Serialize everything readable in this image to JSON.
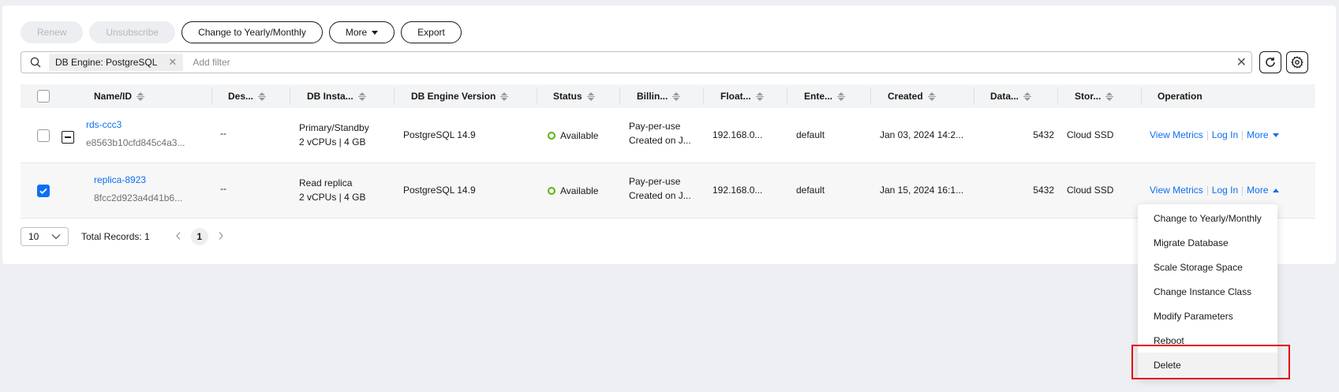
{
  "toolbar": {
    "renew": "Renew",
    "unsubscribe": "Unsubscribe",
    "change": "Change to Yearly/Monthly",
    "more": "More",
    "export": "Export"
  },
  "search": {
    "tag": "DB Engine: PostgreSQL",
    "placeholder": "Add filter"
  },
  "table": {
    "headers": [
      "Name/ID",
      "Des...",
      "DB Insta...",
      "DB Engine Version",
      "Status",
      "Billin...",
      "Float...",
      "Ente...",
      "Created",
      "Data...",
      "Stor...",
      "Operation"
    ],
    "rows": [
      {
        "name": "rds-ccc3",
        "id": "e8563b10cfd845c4a3...",
        "desc": "--",
        "type": "Primary/Standby",
        "spec": "2 vCPUs | 4 GB",
        "engine": "PostgreSQL 14.9",
        "status": "Available",
        "billing": "Pay-per-use",
        "billing2": "Created on J...",
        "ip": "192.168.0...",
        "enterprise": "default",
        "created": "Jan 03, 2024 14:2...",
        "port": "5432",
        "storage": "Cloud SSD",
        "op1": "View Metrics",
        "op2": "Log In",
        "op3": "More"
      },
      {
        "name": "replica-8923",
        "id": "8fcc2d923a4d41b6...",
        "desc": "--",
        "type": "Read replica",
        "spec": "2 vCPUs | 4 GB",
        "engine": "PostgreSQL 14.9",
        "status": "Available",
        "billing": "Pay-per-use",
        "billing2": "Created on J...",
        "ip": "192.168.0...",
        "enterprise": "default",
        "created": "Jan 15, 2024 16:1...",
        "port": "5432",
        "storage": "Cloud SSD",
        "op1": "View Metrics",
        "op2": "Log In",
        "op3": "More"
      }
    ]
  },
  "pager": {
    "size": "10",
    "total": "Total Records: 1",
    "page": "1"
  },
  "dropdown": {
    "items": [
      "Change to Yearly/Monthly",
      "Migrate Database",
      "Scale Storage Space",
      "Change Instance Class",
      "Modify Parameters",
      "Reboot",
      "Delete"
    ]
  },
  "colors": {
    "link": "#0d6ff5",
    "available": "#5cb300",
    "highlight": "#e00000"
  }
}
